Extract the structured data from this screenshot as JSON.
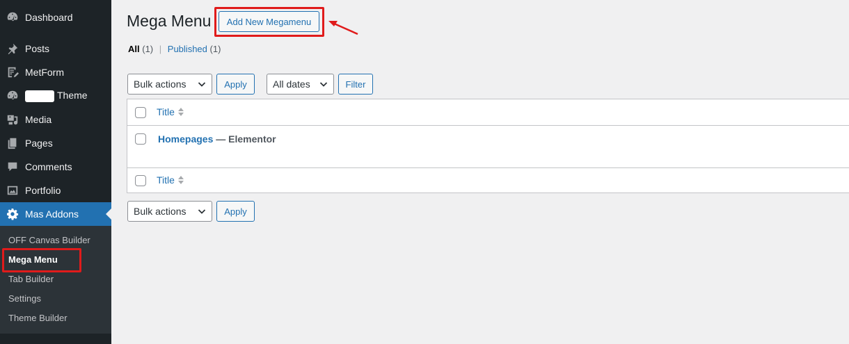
{
  "sidebar": {
    "items": [
      {
        "label": "Dashboard",
        "icon": "dashboard-icon"
      },
      {
        "label": "Posts",
        "icon": "pin-icon"
      },
      {
        "label": "MetForm",
        "icon": "form-icon"
      },
      {
        "label": "Theme",
        "icon": "palette-icon"
      },
      {
        "label": "Media",
        "icon": "media-icon"
      },
      {
        "label": "Pages",
        "icon": "pages-icon"
      },
      {
        "label": "Comments",
        "icon": "comment-icon"
      },
      {
        "label": "Portfolio",
        "icon": "portfolio-icon"
      },
      {
        "label": "Mas Addons",
        "icon": "gear-icon"
      }
    ],
    "submenu": [
      {
        "label": "OFF Canvas Builder"
      },
      {
        "label": "Mega Menu"
      },
      {
        "label": "Tab Builder"
      },
      {
        "label": "Settings"
      },
      {
        "label": "Theme Builder"
      }
    ]
  },
  "header": {
    "title": "Mega Menu",
    "add_new_label": "Add New Megamenu"
  },
  "views": {
    "all_label": "All",
    "all_count": "(1)",
    "separator": "|",
    "published_label": "Published",
    "published_count": "(1)"
  },
  "tablenav_top": {
    "bulk_actions": "Bulk actions",
    "apply": "Apply",
    "all_dates": "All dates",
    "filter": "Filter"
  },
  "table": {
    "column_title": "Title",
    "rows": [
      {
        "title": "Homepages",
        "state": " — Elementor"
      }
    ]
  },
  "tablenav_bottom": {
    "bulk_actions": "Bulk actions",
    "apply": "Apply"
  },
  "colors": {
    "sidebar_bg": "#1d2327",
    "accent": "#2271b1",
    "highlight": "#e01b1b"
  }
}
